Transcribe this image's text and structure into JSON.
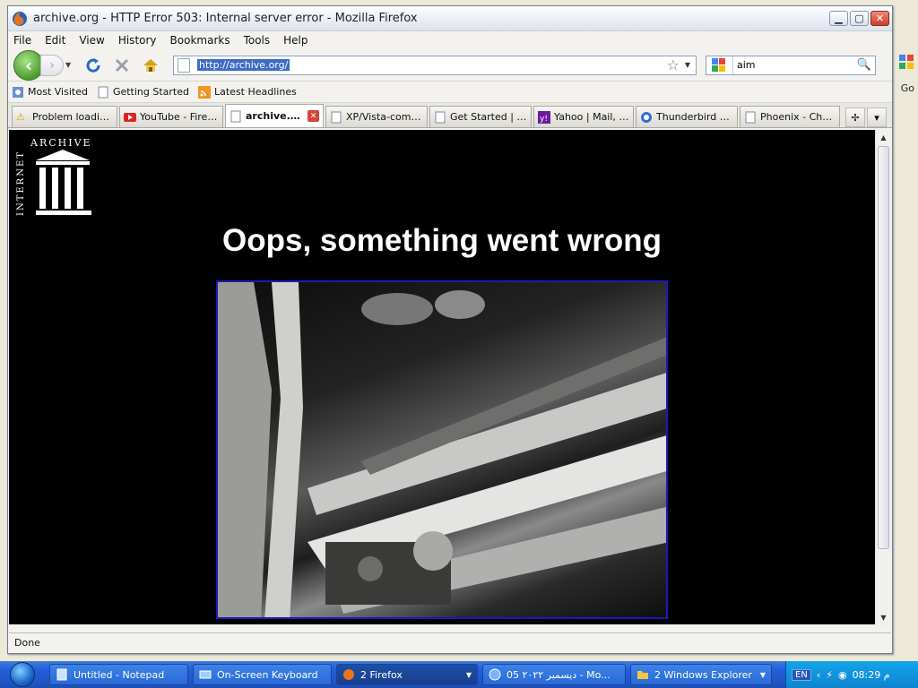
{
  "window": {
    "title": "archive.org - HTTP Error 503: Internal server error - Mozilla Firefox",
    "minimize": "0",
    "maximize": "1",
    "close": "r"
  },
  "background": {
    "go_label": "Go"
  },
  "menu": [
    "File",
    "Edit",
    "View",
    "History",
    "Bookmarks",
    "Tools",
    "Help"
  ],
  "navigation": {
    "url": "http://archive.org/",
    "search_value": "aim"
  },
  "bookmarks": [
    "Most Visited",
    "Getting Started",
    "Latest Headlines"
  ],
  "tabs": [
    {
      "label": "Problem loading...",
      "active": false
    },
    {
      "label": "YouTube - Firef...",
      "active": false
    },
    {
      "label": "archive.o...",
      "active": true
    },
    {
      "label": "XP/Vista-compa...",
      "active": false
    },
    {
      "label": "Get Started | E...",
      "active": false
    },
    {
      "label": "Yahoo | Mail, W...",
      "active": false
    },
    {
      "label": "Thunderbird — ...",
      "active": false
    },
    {
      "label": "Phoenix - Chat ...",
      "active": false
    }
  ],
  "page": {
    "logo_word_archive": "ARCHIVE",
    "logo_word_internet": "INTERNET",
    "heading": "Oops, something went wrong"
  },
  "status": {
    "text": "Done"
  },
  "taskbar": {
    "items": [
      {
        "label": "Untitled - Notepad",
        "active": false
      },
      {
        "label": "On-Screen Keyboard",
        "active": false
      },
      {
        "label": "2 Firefox",
        "active": true
      },
      {
        "label": "05 ديسمبر ٢٠٢٢ - Mo...",
        "active": false
      },
      {
        "label": "2 Windows Explorer",
        "active": false
      }
    ],
    "lang": "EN",
    "clock": "08:29 م"
  },
  "colors": {
    "accent": "#3d6cc6",
    "photo_border": "#1a1ab8",
    "page_background": "#000000"
  }
}
